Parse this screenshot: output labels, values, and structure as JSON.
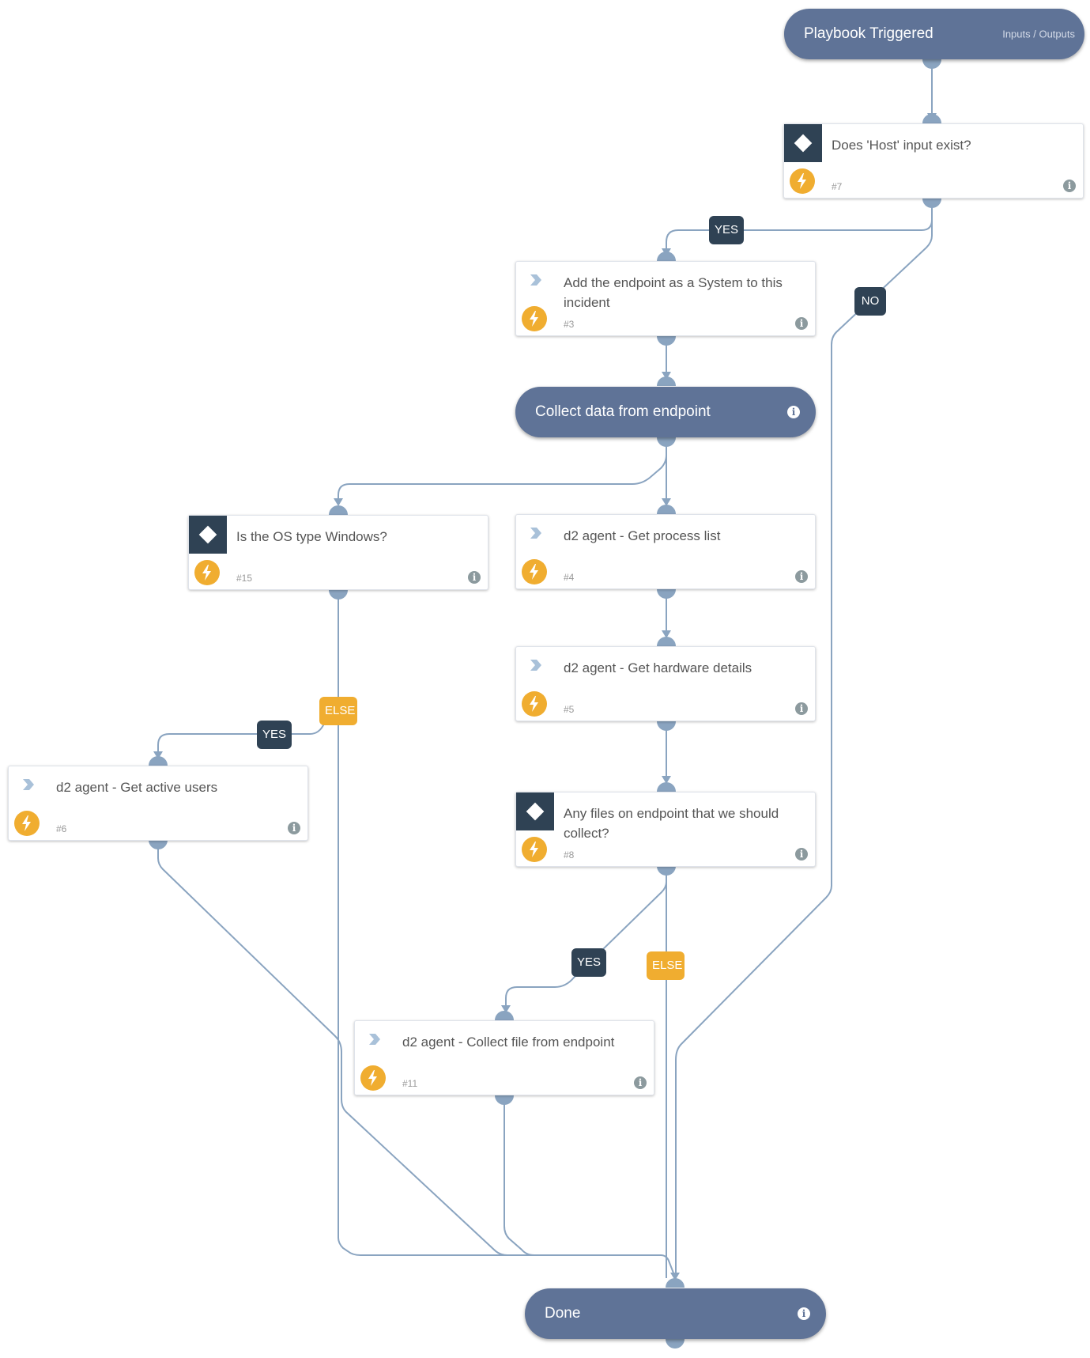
{
  "colors": {
    "pill": "#5f7397",
    "edge": "#8aa4c0",
    "condition_header": "#2f4254",
    "automation_icon": "#f0ad30",
    "yes_no_badge": "#2f4254",
    "else_badge": "#f0ad30"
  },
  "trigger": {
    "title": "Playbook Triggered",
    "io_link": "Inputs / Outputs"
  },
  "tasks": {
    "t7": {
      "type": "condition",
      "label": "Does 'Host' input exist?",
      "number": "#7"
    },
    "t3": {
      "type": "regular",
      "label": "Add the endpoint as a System to this incident",
      "number": "#3"
    },
    "t15": {
      "type": "condition",
      "label": "Is the OS type Windows?",
      "number": "#15"
    },
    "t4": {
      "type": "regular",
      "label": "d2 agent - Get process list",
      "number": "#4"
    },
    "t5": {
      "type": "regular",
      "label": "d2 agent - Get hardware details",
      "number": "#5"
    },
    "t6": {
      "type": "regular",
      "label": "d2 agent - Get active users",
      "number": "#6"
    },
    "t8": {
      "type": "condition",
      "label": "Any files on endpoint that we should collect?",
      "number": "#8"
    },
    "t11": {
      "type": "regular",
      "label": "d2 agent - Collect file from endpoint",
      "number": "#11"
    }
  },
  "section": {
    "title": "Collect data from endpoint"
  },
  "done": {
    "title": "Done"
  },
  "badges": {
    "t7_yes": "YES",
    "t7_no": "NO",
    "t15_else": "ELSE",
    "t15_yes": "YES",
    "t8_yes": "YES",
    "t8_else": "ELSE"
  },
  "info_glyph": "i"
}
